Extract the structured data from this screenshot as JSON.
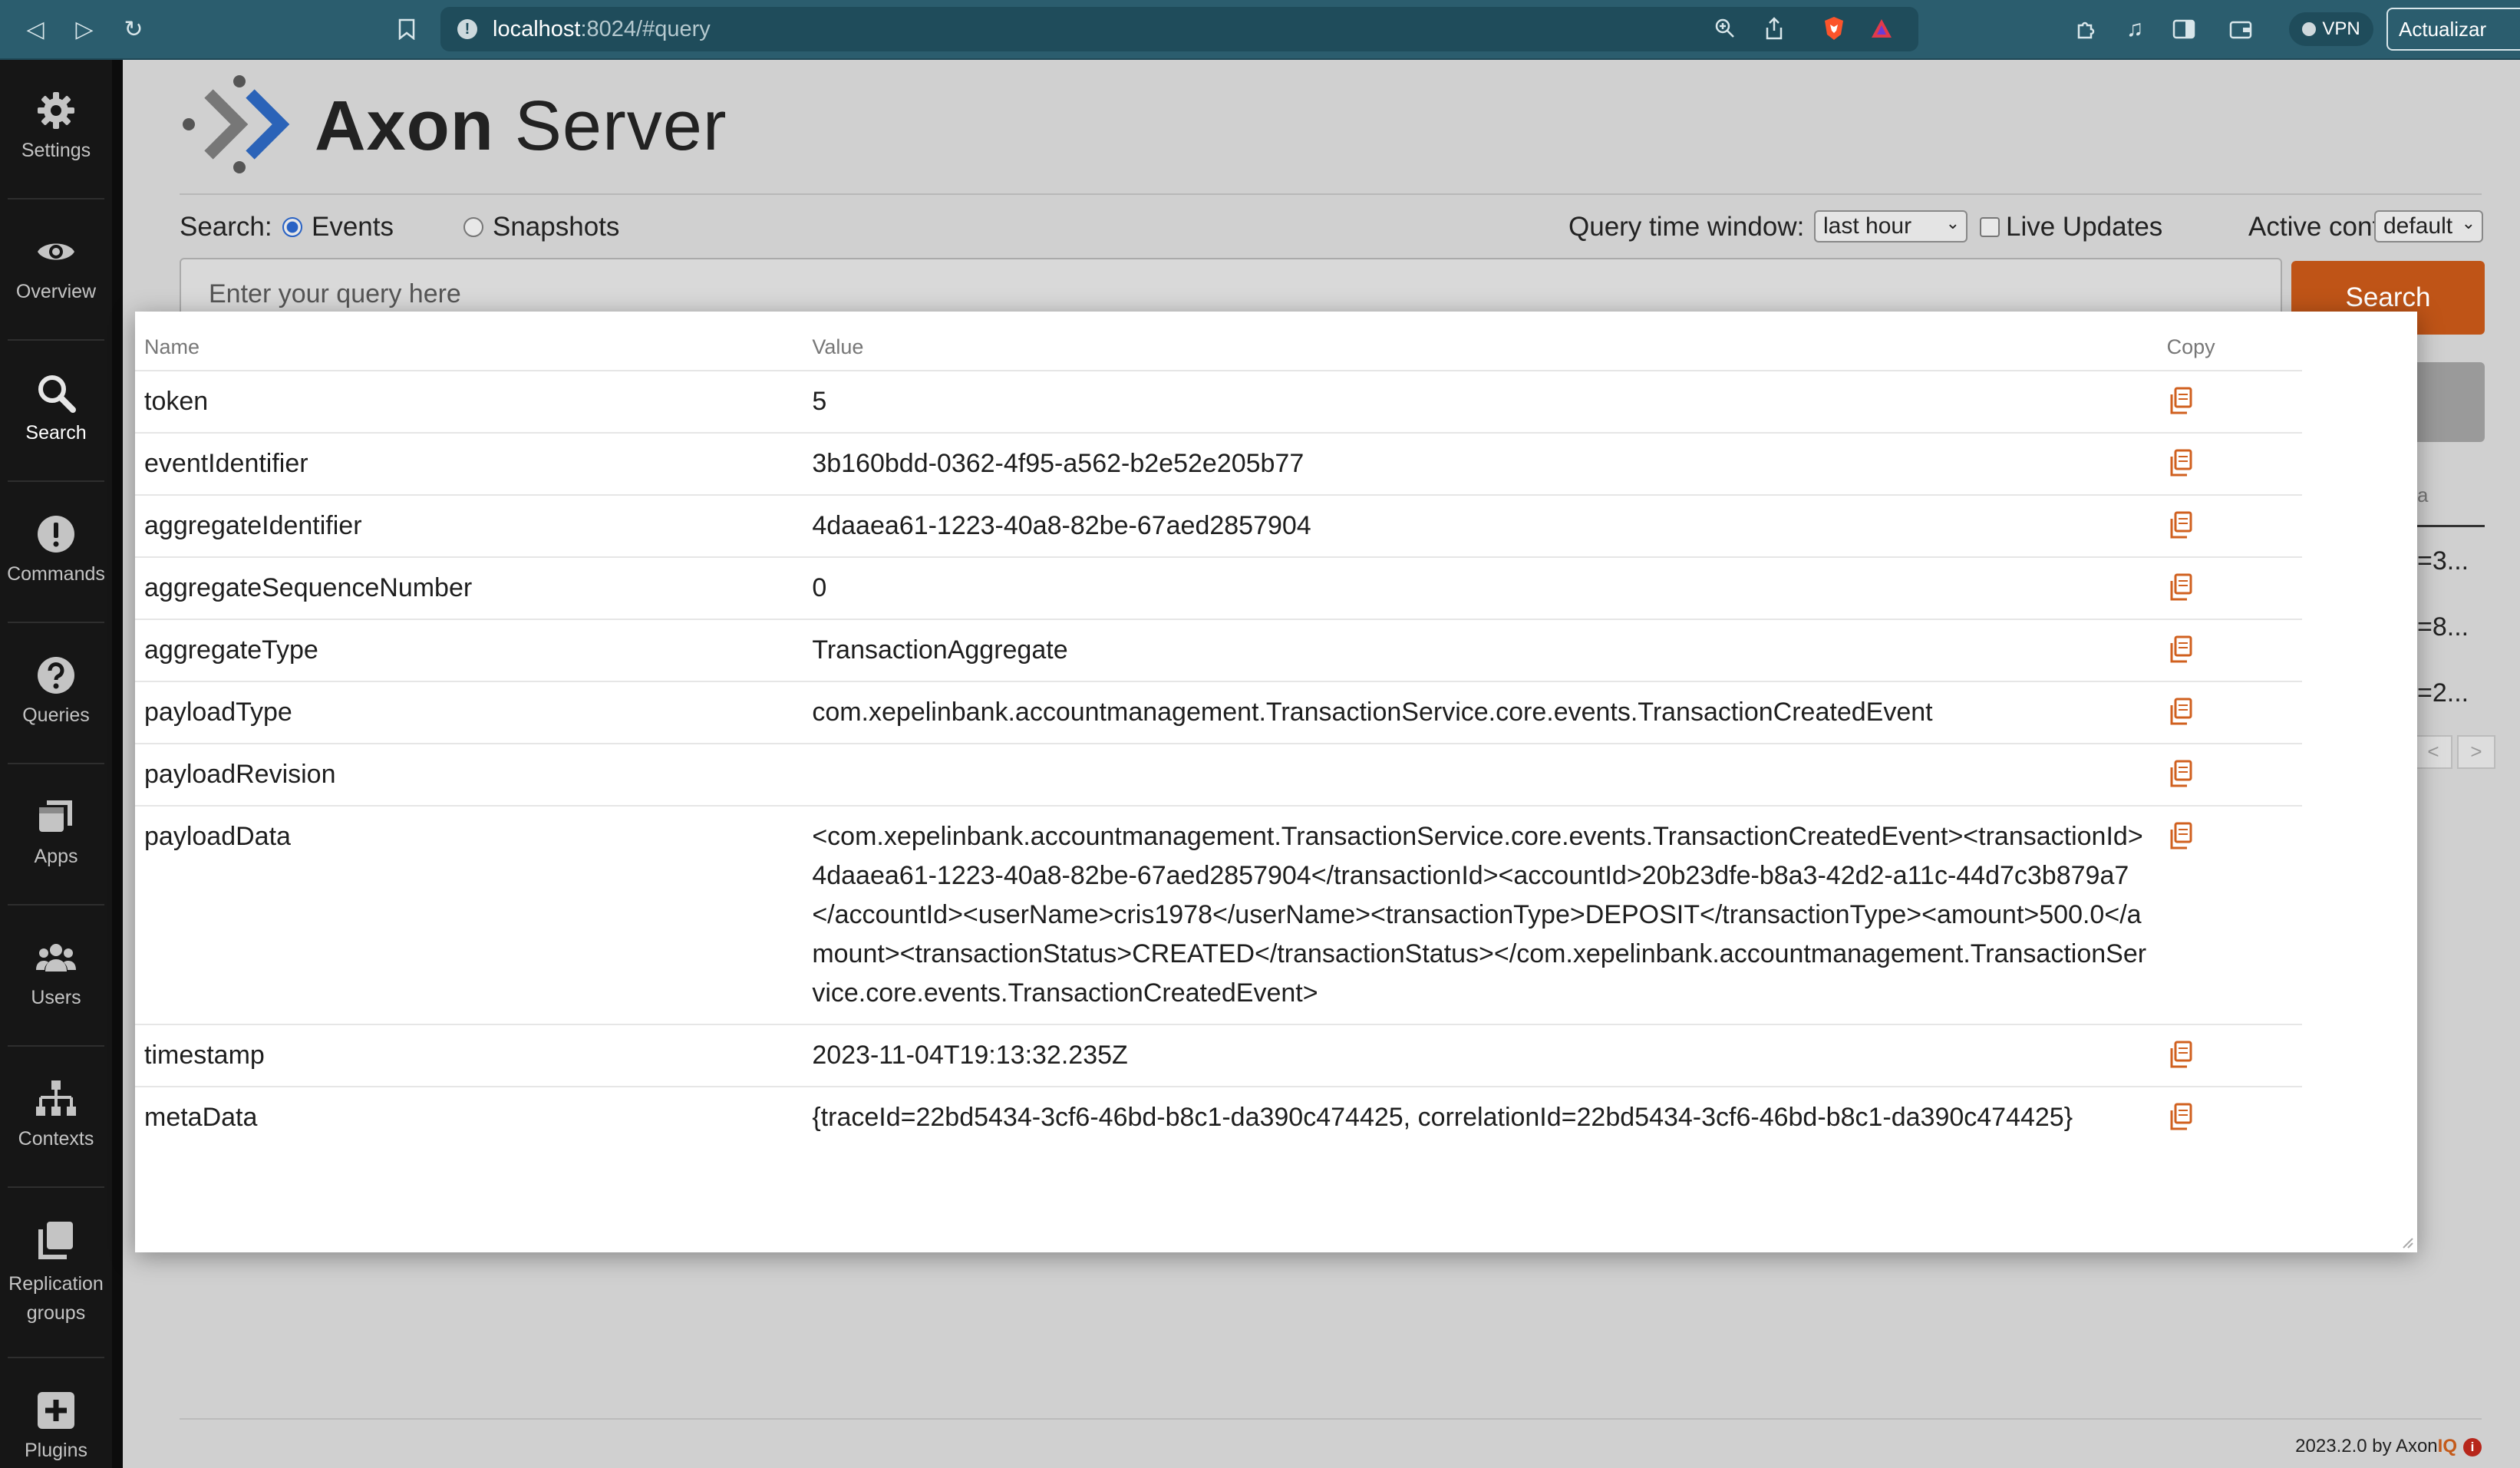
{
  "browser": {
    "url_host": "localhost",
    "url_rest": ":8024/#query",
    "vpn_label": "VPN",
    "update_label": "Actualizar"
  },
  "sidebar": {
    "items": [
      {
        "label": "Settings",
        "icon": "gear-icon"
      },
      {
        "label": "Overview",
        "icon": "eye-icon"
      },
      {
        "label": "Search",
        "icon": "search-icon"
      },
      {
        "label": "Commands",
        "icon": "exclamation-icon"
      },
      {
        "label": "Queries",
        "icon": "question-icon"
      },
      {
        "label": "Apps",
        "icon": "apps-icon"
      },
      {
        "label": "Users",
        "icon": "users-icon"
      },
      {
        "label": "Contexts",
        "icon": "hierarchy-icon"
      },
      {
        "label": "Replication groups",
        "icon": "copy-stack-icon"
      },
      {
        "label": "Plugins",
        "icon": "plus-square-icon"
      }
    ]
  },
  "app": {
    "logo_bold": "Axon",
    "logo_light": "Server",
    "search_label": "Search:",
    "radio_events": "Events",
    "radio_snapshots": "Snapshots",
    "time_window_label": "Query time window:",
    "time_window_value": "last hour",
    "live_updates_label": "Live Updates",
    "context_label": "Active context:",
    "context_value": "default",
    "query_placeholder": "Enter your query here",
    "search_button": "Search",
    "bg_header_partial": "a",
    "bg_cells": [
      "=3...",
      "=8...",
      "=2..."
    ],
    "pager_prev": "<",
    "pager_next": ">",
    "footer_version": "2023.2.0 by Axon",
    "footer_iq": "IQ"
  },
  "modal": {
    "columns": {
      "name": "Name",
      "value": "Value",
      "copy": "Copy"
    },
    "rows": [
      {
        "name": "token",
        "value": "5"
      },
      {
        "name": "eventIdentifier",
        "value": "3b160bdd-0362-4f95-a562-b2e52e205b77"
      },
      {
        "name": "aggregateIdentifier",
        "value": "4daaea61-1223-40a8-82be-67aed2857904"
      },
      {
        "name": "aggregateSequenceNumber",
        "value": "0"
      },
      {
        "name": "aggregateType",
        "value": "TransactionAggregate"
      },
      {
        "name": "payloadType",
        "value": "com.xepelinbank.accountmanagement.TransactionService.core.events.TransactionCreatedEvent"
      },
      {
        "name": "payloadRevision",
        "value": ""
      },
      {
        "name": "payloadData",
        "value": "<com.xepelinbank.accountmanagement.TransactionService.core.events.TransactionCreatedEvent><transactionId>4daaea61-1223-40a8-82be-67aed2857904</transactionId><accountId>20b23dfe-b8a3-42d2-a11c-44d7c3b879a7</accountId><userName>cris1978</userName><transactionType>DEPOSIT</transactionType><amount>500.0</amount><transactionStatus>CREATED</transactionStatus></com.xepelinbank.accountmanagement.TransactionService.core.events.TransactionCreatedEvent>"
      },
      {
        "name": "timestamp",
        "value": "2023-11-04T19:13:32.235Z"
      },
      {
        "name": "metaData",
        "value": "{traceId=22bd5434-3cf6-46bd-b8c1-da390c474425, correlationId=22bd5434-3cf6-46bd-b8c1-da390c474425}"
      }
    ]
  }
}
